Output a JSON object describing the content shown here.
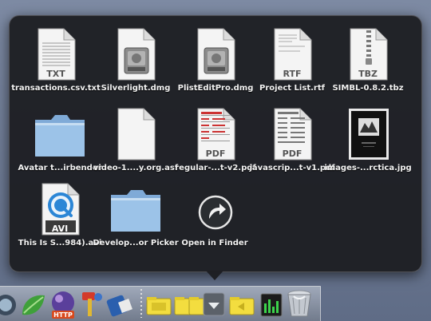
{
  "stack": {
    "items": [
      {
        "label": "transactions.csv.txt",
        "badge": "TXT",
        "icon": "text-document-icon"
      },
      {
        "label": "Silverlight.dmg",
        "badge": "",
        "icon": "disk-image-icon"
      },
      {
        "label": "PlistEditPro.dmg",
        "badge": "",
        "icon": "disk-image-icon"
      },
      {
        "label": "Project List.rtf",
        "badge": "RTF",
        "icon": "rtf-document-icon"
      },
      {
        "label": "SIMBL-0.8.2.tbz",
        "badge": "TBZ",
        "icon": "archive-icon"
      },
      {
        "label": "Avatar t...irbender",
        "badge": "",
        "icon": "folder-icon"
      },
      {
        "label": "video-1....y.org.asf",
        "badge": "",
        "icon": "blank-document-icon"
      },
      {
        "label": "regular-...t-v2.pdf",
        "badge": "PDF",
        "icon": "pdf-document-icon"
      },
      {
        "label": "javascrip...t-v1.pdf",
        "badge": "PDF",
        "icon": "pdf-document-icon"
      },
      {
        "label": "images-...rctica.jpg",
        "badge": "",
        "icon": "jpeg-image-icon"
      },
      {
        "label": "This Is S...984).avi",
        "badge": "AVI",
        "icon": "avi-video-icon"
      },
      {
        "label": "Develop...or Picker",
        "badge": "",
        "icon": "folder-icon"
      },
      {
        "label": "Open in Finder",
        "badge": "",
        "icon": "open-in-finder-icon"
      }
    ]
  },
  "dock": {
    "items": [
      "quicktime-icon",
      "leaf-icon",
      "http-globe-icon",
      "hammer-icon",
      "tool-icon",
      "stack-folder-icon",
      "stack-folder-icon",
      "stack-folder-icon",
      "stack-expand-icon",
      "stack-folder-icon",
      "activity-monitor-icon",
      "trash-icon"
    ]
  },
  "colors": {
    "panel": "#1c1e22",
    "folder": "#88b4df",
    "label": "#f3f3f3",
    "avi": "#2b86d6"
  }
}
